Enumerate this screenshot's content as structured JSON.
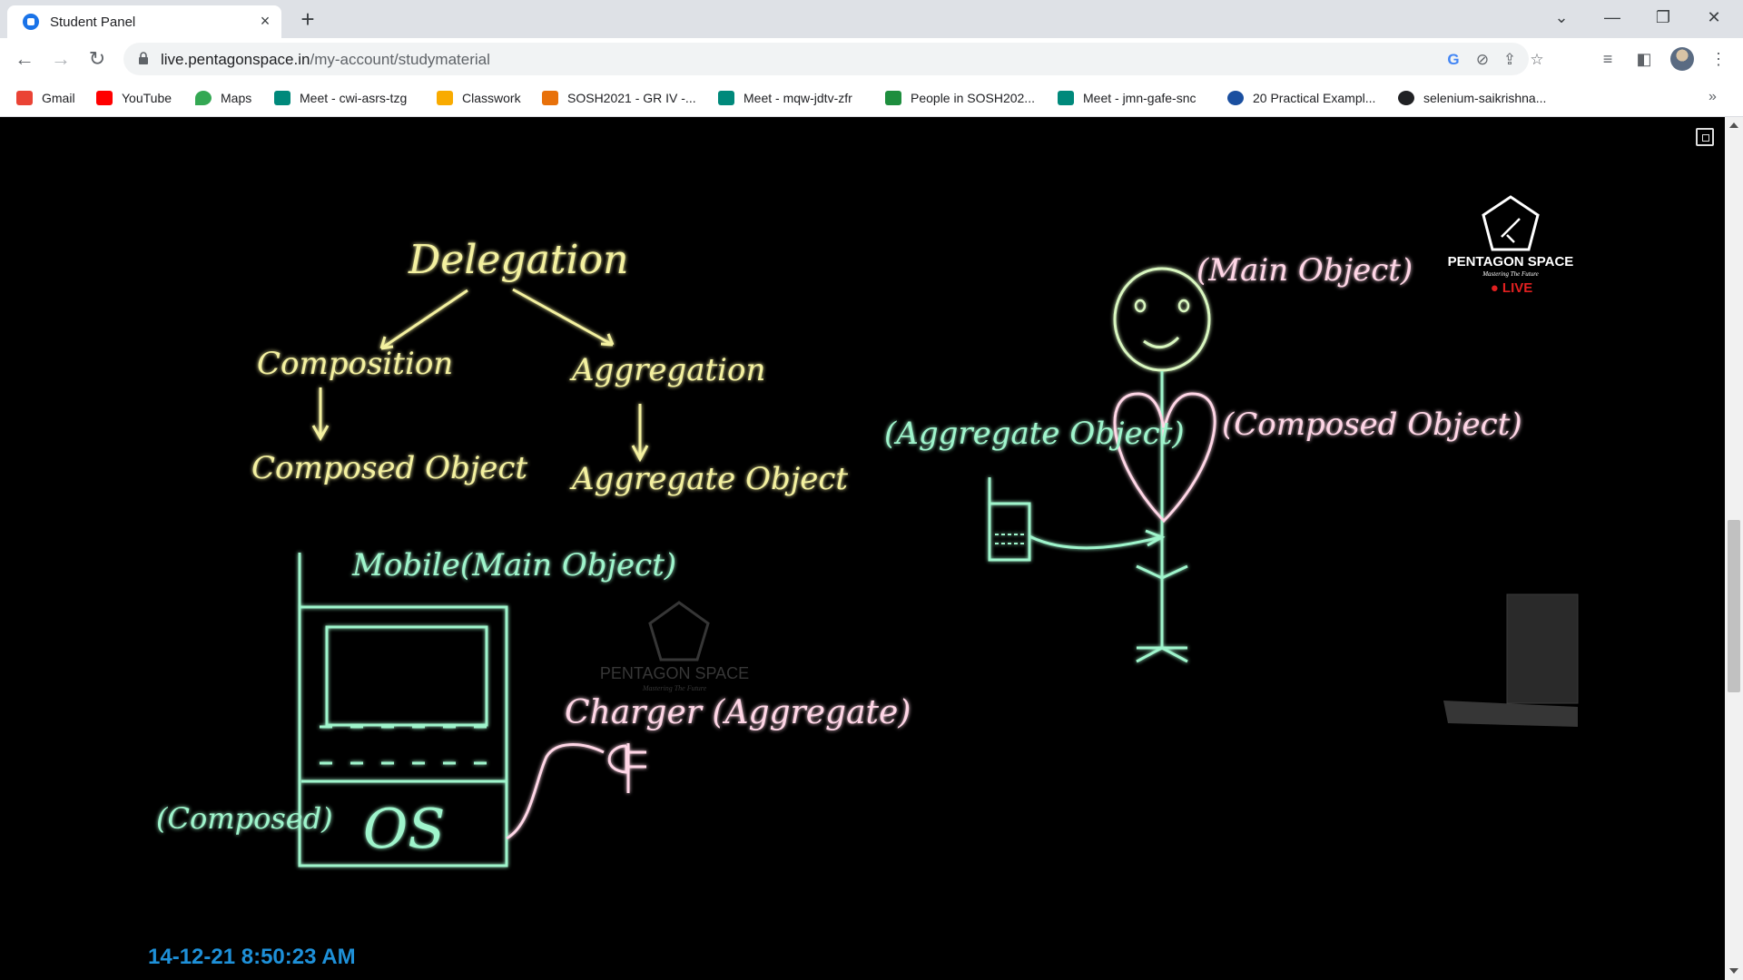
{
  "browser": {
    "tab": {
      "title": "Student Panel",
      "close_glyph": "×"
    },
    "new_tab_glyph": "+",
    "window_controls": {
      "tab_search": "⌄",
      "minimize": "—",
      "restore": "❐",
      "close": "✕"
    },
    "url": {
      "host": "live.pentagonspace.in",
      "path": "/my-account/studymaterial"
    },
    "bookmarks": [
      {
        "label": "Gmail",
        "icon": "gmail-icon",
        "color": "#ea4335"
      },
      {
        "label": "YouTube",
        "icon": "youtube-icon",
        "color": "#ff0000"
      },
      {
        "label": "Maps",
        "icon": "maps-icon",
        "color": "#34a853"
      },
      {
        "label": "Meet - cwi-asrs-tzg",
        "icon": "meet-icon",
        "color": "#00897b"
      },
      {
        "label": "Classwork",
        "icon": "classroom-icon",
        "color": "#f9ab00"
      },
      {
        "label": "SOSH2021 - GR IV -...",
        "icon": "sheets-icon",
        "color": "#e8710a"
      },
      {
        "label": "Meet - mqw-jdtv-zfr",
        "icon": "meet-icon",
        "color": "#00897b"
      },
      {
        "label": "People in SOSH202...",
        "icon": "classroom-icon",
        "color": "#1e8e3e"
      },
      {
        "label": "Meet - jmn-gafe-snc",
        "icon": "meet-icon",
        "color": "#00897b"
      },
      {
        "label": "20 Practical Exampl...",
        "icon": "shield-icon",
        "color": "#1a4fa0"
      },
      {
        "label": "selenium-saikrishna...",
        "icon": "github-icon",
        "color": "#202124"
      }
    ],
    "bookmarks_overflow": "»"
  },
  "board": {
    "title": "Delegation",
    "left_branch": "Composition",
    "left_result": "Composed Object",
    "right_branch": "Aggregation",
    "right_result": "Aggregate Object",
    "mobile_label": "Mobile(Main Object)",
    "os_label": "OS",
    "composed_label": "(Composed)",
    "charger_label": "Charger (Aggregate)",
    "main_object_label": "(Main Object)",
    "aggregate_object_label": "(Aggregate Object)",
    "composed_object_label": "(Composed Object)",
    "watermark_brand": "PENTAGON SPACE",
    "watermark_tagline": "Mastering The Future",
    "live_badge": "● LIVE",
    "timestamp": "14-12-21 8:50:23 AM"
  },
  "colors": {
    "chalk_yellow": "#f4f1a0",
    "chalk_green": "#9ff5cc",
    "chalk_pink": "#ffd6e6",
    "live_red": "#e02020",
    "timestamp_blue": "#1e90d8"
  }
}
